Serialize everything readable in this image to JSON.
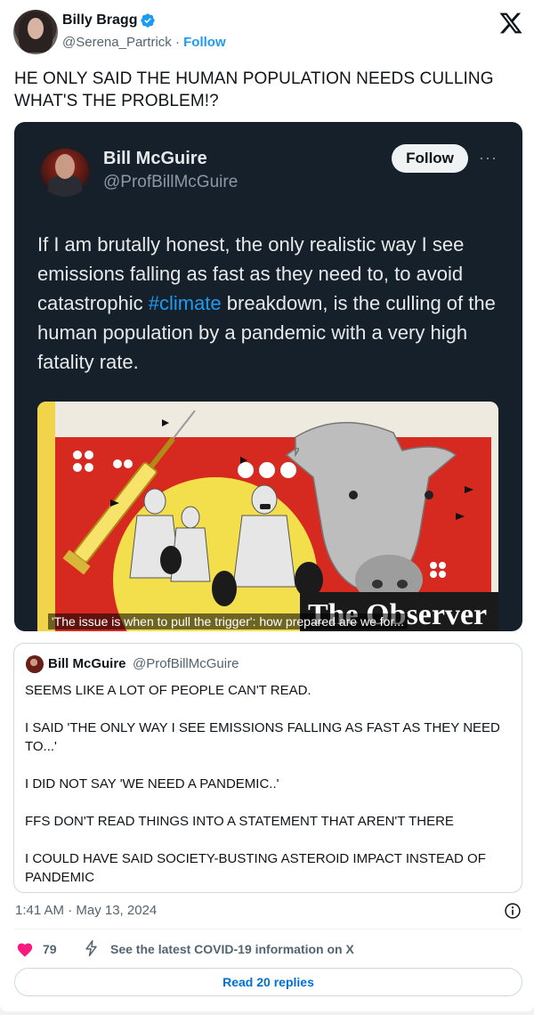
{
  "author": {
    "name": "Billy Bragg",
    "handle": "@Serena_Partrick",
    "separator": "·",
    "follow_label": "Follow"
  },
  "tweet_text": "HE ONLY SAID THE HUMAN POPULATION NEEDS CULLING WHAT'S THE PROBLEM!?",
  "embedded_screenshot": {
    "name": "Bill McGuire",
    "handle": "@ProfBillMcGuire",
    "follow_label": "Follow",
    "more_label": "···",
    "text_before": "If I am brutally honest, the only realistic way I see emissions falling as fast as they need to, to avoid catastrophic ",
    "hashtag": "#climate",
    "text_after": " breakdown, is the culling of the human population by a pandemic with a very high fatality rate.",
    "image_caption": "'The issue is when to pull the trigger': how prepared are we for...",
    "image_masthead": "The Observer"
  },
  "quoted_tweet": {
    "name": "Bill McGuire",
    "handle": "@ProfBillMcGuire",
    "lines": [
      "SEEMS LIKE A LOT OF PEOPLE CAN'T READ.",
      "I SAID 'THE ONLY WAY I SEE EMISSIONS FALLING AS FAST AS THEY NEED TO...'",
      "I DID NOT SAY 'WE NEED A PANDEMIC..'",
      "FFS DON'T READ THINGS INTO A STATEMENT THAT AREN'T THERE",
      "I COULD HAVE SAID SOCIETY-BUSTING ASTEROID IMPACT INSTEAD OF PANDEMIC"
    ]
  },
  "timestamp": "1:41 AM · May 13, 2024",
  "actions": {
    "likes": "79",
    "covid_info": "See the latest COVID-19 information on X",
    "read_replies": "Read 20 replies"
  },
  "icons": {
    "verified": "verified-badge-icon",
    "x_logo": "x-logo-icon",
    "info": "info-icon",
    "heart": "heart-icon",
    "bolt": "lightning-icon"
  },
  "colors": {
    "accent": "#1d9bf0",
    "like": "#f91880",
    "dark_bg": "#15202b"
  }
}
